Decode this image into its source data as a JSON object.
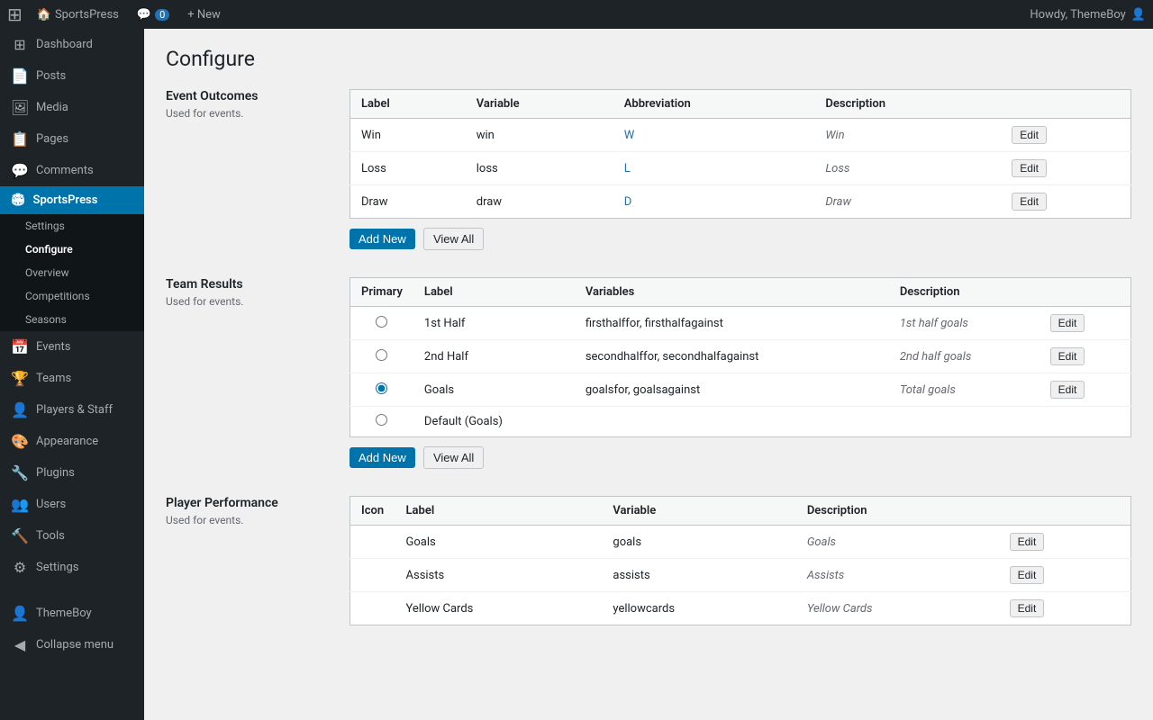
{
  "topbar": {
    "wp_logo": "⊞",
    "site_name": "SportsPress",
    "comments_icon": "💬",
    "comments_count": "0",
    "new_label": "+ New",
    "howdy": "Howdy, ThemeBoy"
  },
  "sidebar": {
    "items": [
      {
        "id": "dashboard",
        "label": "Dashboard",
        "icon": "⊞"
      },
      {
        "id": "posts",
        "label": "Posts",
        "icon": "📄"
      },
      {
        "id": "media",
        "label": "Media",
        "icon": "🖼"
      },
      {
        "id": "pages",
        "label": "Pages",
        "icon": "📋"
      },
      {
        "id": "comments",
        "label": "Comments",
        "icon": "💬"
      },
      {
        "id": "sportspress",
        "label": "SportsPress",
        "icon": "🏟"
      },
      {
        "id": "settings-sub",
        "label": "Settings",
        "submenu": true
      },
      {
        "id": "configure-sub",
        "label": "Configure",
        "submenu": true,
        "active": true
      },
      {
        "id": "overview-sub",
        "label": "Overview",
        "submenu": true
      },
      {
        "id": "competitions-sub",
        "label": "Competitions",
        "submenu": true
      },
      {
        "id": "seasons-sub",
        "label": "Seasons",
        "submenu": true
      },
      {
        "id": "events",
        "label": "Events",
        "icon": "📅"
      },
      {
        "id": "teams",
        "label": "Teams",
        "icon": "🏆"
      },
      {
        "id": "players-staff",
        "label": "Players & Staff",
        "icon": "👤"
      },
      {
        "id": "appearance",
        "label": "Appearance",
        "icon": "🎨"
      },
      {
        "id": "plugins",
        "label": "Plugins",
        "icon": "🔧"
      },
      {
        "id": "users",
        "label": "Users",
        "icon": "👥"
      },
      {
        "id": "tools",
        "label": "Tools",
        "icon": "🔨"
      },
      {
        "id": "settings",
        "label": "Settings",
        "icon": "⚙"
      },
      {
        "id": "themeboy",
        "label": "ThemeBoy",
        "icon": "👤"
      },
      {
        "id": "collapse",
        "label": "Collapse menu",
        "icon": "◀"
      }
    ]
  },
  "page": {
    "title": "Configure"
  },
  "event_outcomes": {
    "section_title": "Event Outcomes",
    "section_desc": "Used for events.",
    "columns": [
      "Label",
      "Variable",
      "Abbreviation",
      "Description"
    ],
    "rows": [
      {
        "label": "Win",
        "variable": "win",
        "abbreviation": "W",
        "description": "Win"
      },
      {
        "label": "Loss",
        "variable": "loss",
        "abbreviation": "L",
        "description": "Loss"
      },
      {
        "label": "Draw",
        "variable": "draw",
        "abbreviation": "D",
        "description": "Draw"
      }
    ],
    "add_new": "Add New",
    "view_all": "View All",
    "edit": "Edit"
  },
  "team_results": {
    "section_title": "Team Results",
    "section_desc": "Used for events.",
    "columns": [
      "Primary",
      "Label",
      "Variables",
      "Description"
    ],
    "rows": [
      {
        "label": "1st Half",
        "variables": "firsthalffor, firsthalfagainst",
        "description": "1st half goals",
        "radio": false
      },
      {
        "label": "2nd Half",
        "variables": "secondhalffor, secondhalfagainst",
        "description": "2nd half goals",
        "radio": false
      },
      {
        "label": "Goals",
        "variables": "goalsfor, goalsagainst",
        "description": "Total goals",
        "radio": true
      },
      {
        "label": "Default (Goals)",
        "variables": "",
        "description": "",
        "radio": false,
        "no_edit": true
      }
    ],
    "add_new": "Add New",
    "view_all": "View All",
    "edit": "Edit"
  },
  "player_performance": {
    "section_title": "Player Performance",
    "section_desc": "Used for events.",
    "columns": [
      "Icon",
      "Label",
      "Variable",
      "Description"
    ],
    "rows": [
      {
        "label": "Goals",
        "variable": "goals",
        "description": "Goals"
      },
      {
        "label": "Assists",
        "variable": "assists",
        "description": "Assists"
      },
      {
        "label": "Yellow Cards",
        "variable": "yellowcards",
        "description": "Yellow Cards"
      }
    ],
    "edit": "Edit"
  }
}
